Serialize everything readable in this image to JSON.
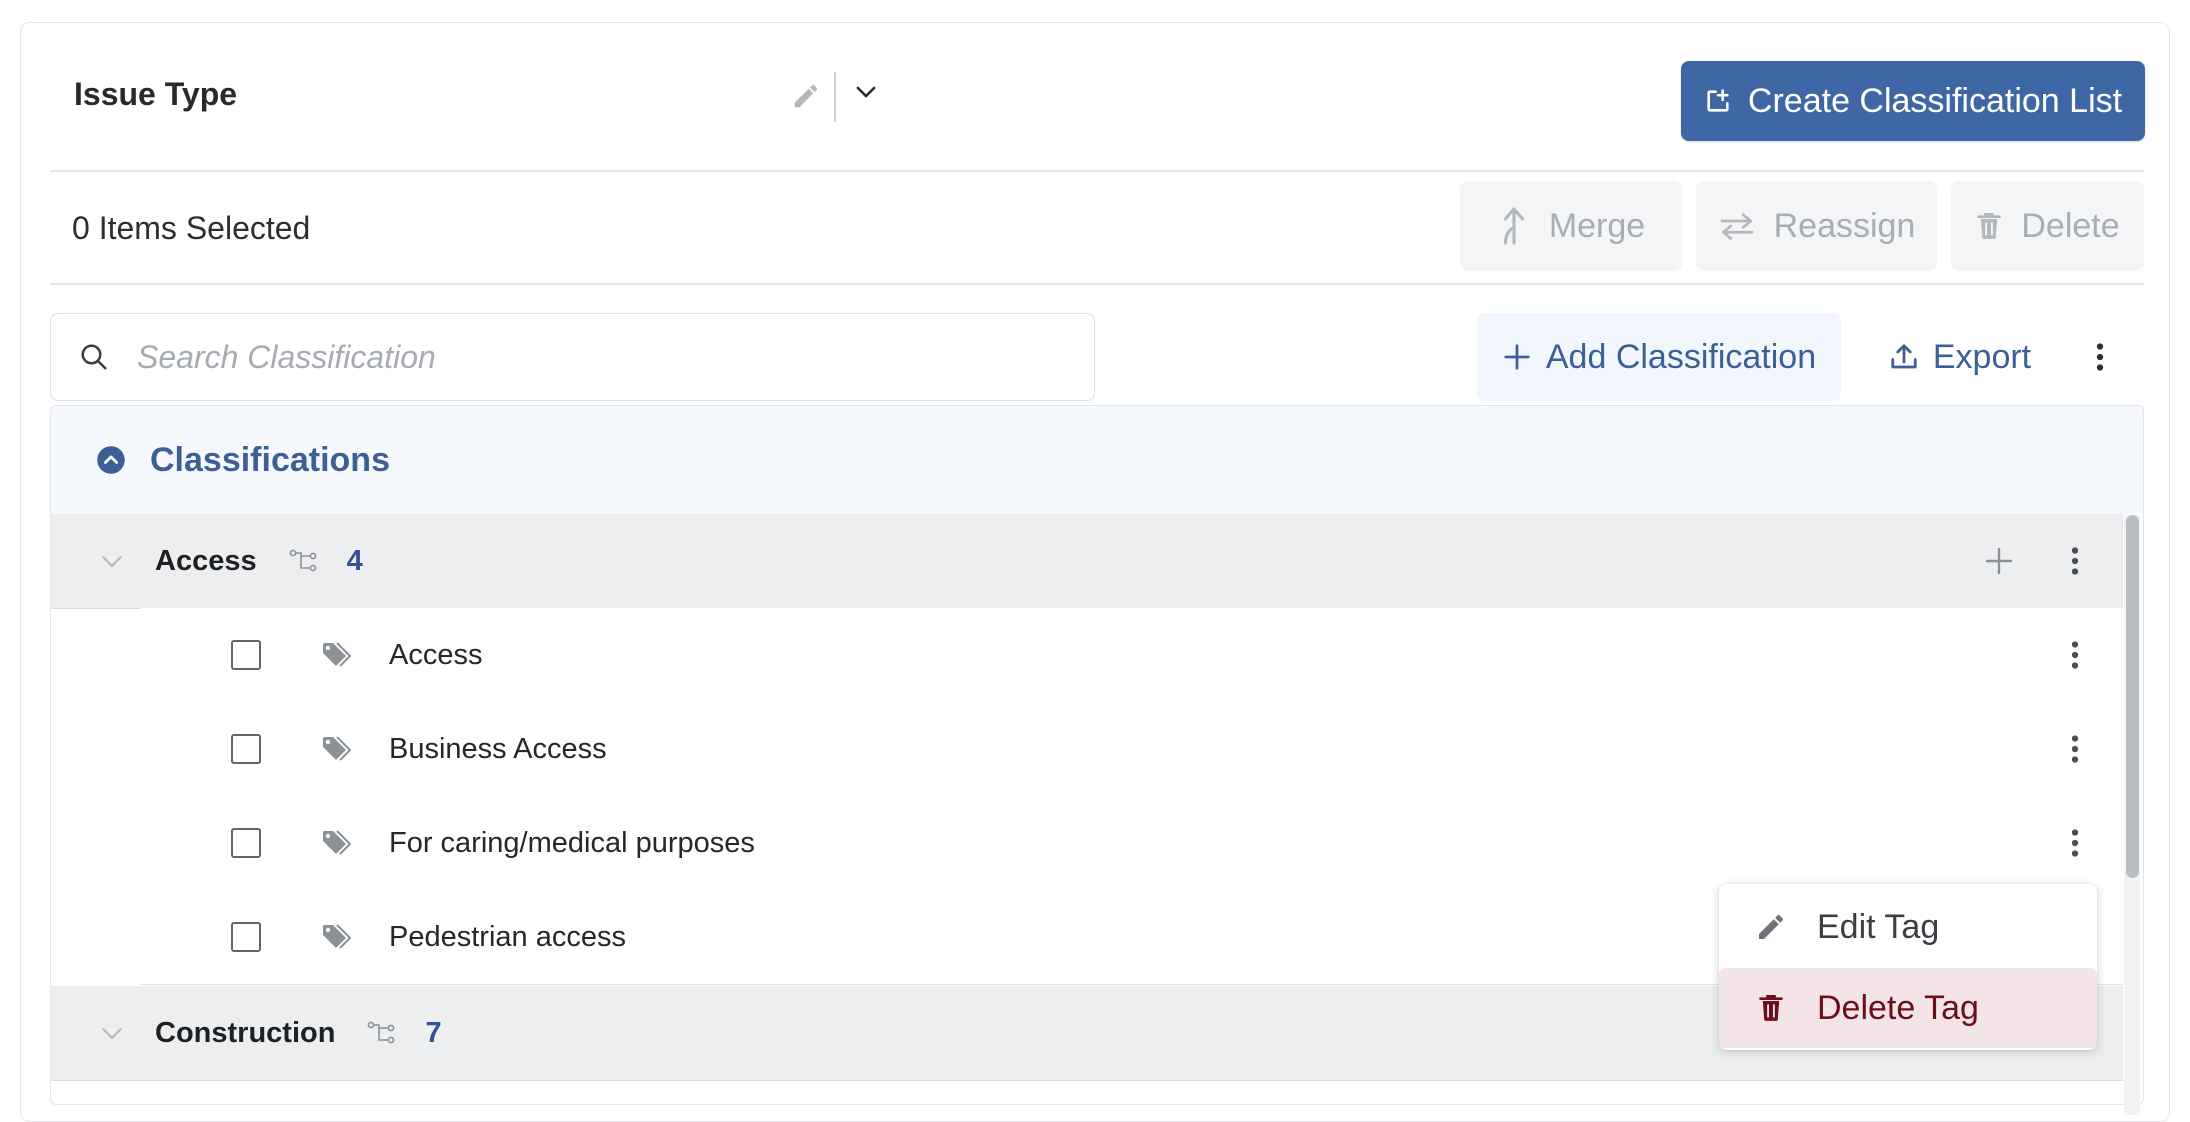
{
  "header": {
    "list_title": "Issue Type",
    "create_label": "Create Classification List"
  },
  "toolbar": {
    "selected_count": "0 Items Selected",
    "merge_label": "Merge",
    "reassign_label": "Reassign",
    "delete_label": "Delete"
  },
  "search": {
    "placeholder": "Search Classification",
    "value": ""
  },
  "actions": {
    "add_label": "Add Classification",
    "export_label": "Export"
  },
  "panel": {
    "title": "Classifications"
  },
  "groups": [
    {
      "name": "Access",
      "count": "4",
      "items": [
        {
          "label": "Access"
        },
        {
          "label": "Business Access"
        },
        {
          "label": "For caring/medical purposes"
        },
        {
          "label": "Pedestrian access"
        }
      ]
    },
    {
      "name": "Construction",
      "count": "7"
    }
  ],
  "context_menu": {
    "edit_label": "Edit Tag",
    "delete_label": "Delete Tag"
  },
  "colors": {
    "primary": "#3f67a5",
    "accent_text": "#3c5f96",
    "danger": "#6b0f1a",
    "danger_bg": "#f3e4e7"
  }
}
